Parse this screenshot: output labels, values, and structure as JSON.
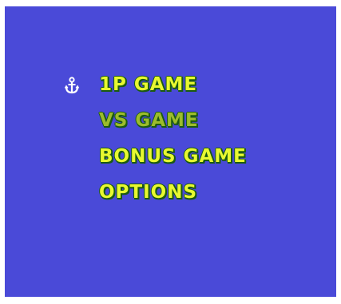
{
  "menu": {
    "items": [
      {
        "label": "1P GAME",
        "selected": true
      },
      {
        "label": "VS GAME",
        "selected": false
      },
      {
        "label": "BONUS GAME",
        "selected": false
      },
      {
        "label": "OPTIONS",
        "selected": false
      }
    ],
    "cursor_icon": "anchor-icon"
  },
  "colors": {
    "background": "#4a4ad8",
    "text": "#e8f830",
    "text_dim": "#9cbc2c",
    "outline": "#1a5a10"
  }
}
